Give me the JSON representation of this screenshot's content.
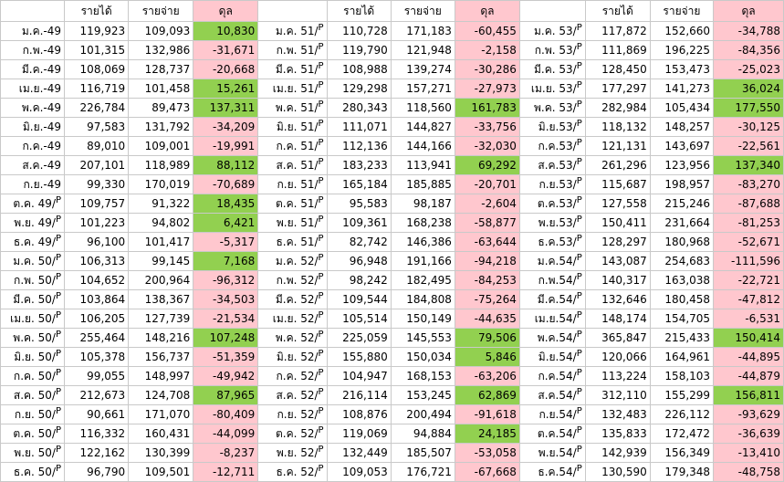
{
  "headers": {
    "income": "รายได้",
    "expense": "รายจ่าย",
    "balance": "ดุล"
  },
  "colors": {
    "surplus": "#92d050",
    "deficit": "#ffc7ce"
  },
  "rows": [
    [
      [
        "ม.ค.-49",
        "",
        "119,923",
        "109,093",
        "10,830"
      ],
      [
        "ม.ค. 51/",
        "P",
        "110,728",
        "171,183",
        "-60,455"
      ],
      [
        "ม.ค. 53/",
        "P",
        "117,872",
        "152,660",
        "-34,788"
      ]
    ],
    [
      [
        "ก.พ.-49",
        "",
        "101,315",
        "132,986",
        "-31,671"
      ],
      [
        "ก.พ. 51/",
        "P",
        "119,790",
        "121,948",
        "-2,158"
      ],
      [
        "ก.พ. 53/",
        "P",
        "111,869",
        "196,225",
        "-84,356"
      ]
    ],
    [
      [
        "มี.ค.-49",
        "",
        "108,069",
        "128,737",
        "-20,668"
      ],
      [
        "มี.ค. 51/",
        "P",
        "108,988",
        "139,274",
        "-30,286"
      ],
      [
        "มี.ค. 53/",
        "P",
        "128,450",
        "153,473",
        "-25,023"
      ]
    ],
    [
      [
        "เม.ย.-49",
        "",
        "116,719",
        "101,458",
        "15,261"
      ],
      [
        "เม.ย. 51/",
        "P",
        "129,298",
        "157,271",
        "-27,973"
      ],
      [
        "เม.ย. 53/",
        "P",
        "177,297",
        "141,273",
        "36,024"
      ]
    ],
    [
      [
        "พ.ค.-49",
        "",
        "226,784",
        "89,473",
        "137,311"
      ],
      [
        "พ.ค. 51/",
        "P",
        "280,343",
        "118,560",
        "161,783"
      ],
      [
        "พ.ค. 53/",
        "P",
        "282,984",
        "105,434",
        "177,550"
      ]
    ],
    [
      [
        "มิ.ย.-49",
        "",
        "97,583",
        "131,792",
        "-34,209"
      ],
      [
        "มิ.ย. 51/",
        "P",
        "111,071",
        "144,827",
        "-33,756"
      ],
      [
        "มิ.ย.53/",
        "P",
        "118,132",
        "148,257",
        "-30,125"
      ]
    ],
    [
      [
        "ก.ค.-49",
        "",
        "89,010",
        "109,001",
        "-19,991"
      ],
      [
        "ก.ค. 51/",
        "P",
        "112,136",
        "144,166",
        "-32,030"
      ],
      [
        "ก.ค.53/",
        "P",
        "121,131",
        "143,697",
        "-22,561"
      ]
    ],
    [
      [
        "ส.ค.-49",
        "",
        "207,101",
        "118,989",
        "88,112"
      ],
      [
        "ส.ค. 51/",
        "P",
        "183,233",
        "113,941",
        "69,292"
      ],
      [
        "ส.ค.53/",
        "P",
        "261,296",
        "123,956",
        "137,340"
      ]
    ],
    [
      [
        "ก.ย.-49",
        "",
        "99,330",
        "170,019",
        "-70,689"
      ],
      [
        "ก.ย. 51/",
        "P",
        "165,184",
        "185,885",
        "-20,701"
      ],
      [
        "ก.ย.53/",
        "P",
        "115,687",
        "198,957",
        "-83,270"
      ]
    ],
    [
      [
        "ต.ค. 49/",
        "P",
        "109,757",
        "91,322",
        "18,435"
      ],
      [
        "ต.ค. 51/",
        "P",
        "95,583",
        "98,187",
        "-2,604"
      ],
      [
        "ต.ค.53/",
        "P",
        "127,558",
        "215,246",
        "-87,688"
      ]
    ],
    [
      [
        "พ.ย. 49/",
        "P",
        "101,223",
        "94,802",
        "6,421"
      ],
      [
        "พ.ย. 51/",
        "P",
        "109,361",
        "168,238",
        "-58,877"
      ],
      [
        "พ.ย.53/",
        "P",
        "150,411",
        "231,664",
        "-81,253"
      ]
    ],
    [
      [
        "ธ.ค. 49/",
        "P",
        "96,100",
        "101,417",
        "-5,317"
      ],
      [
        "ธ.ค. 51/",
        "P",
        "82,742",
        "146,386",
        "-63,644"
      ],
      [
        "ธ.ค.53/",
        "P",
        "128,297",
        "180,968",
        "-52,671"
      ]
    ],
    [
      [
        "ม.ค. 50/",
        "P",
        "106,313",
        "99,145",
        "7,168"
      ],
      [
        "ม.ค. 52/",
        "P",
        "96,948",
        "191,166",
        "-94,218"
      ],
      [
        "ม.ค.54/",
        "P",
        "143,087",
        "254,683",
        "-111,596"
      ]
    ],
    [
      [
        "ก.พ. 50/",
        "P",
        "104,652",
        "200,964",
        "-96,312"
      ],
      [
        "ก.พ. 52/",
        "P",
        "98,242",
        "182,495",
        "-84,253"
      ],
      [
        "ก.พ.54/",
        "P",
        "140,317",
        "163,038",
        "-22,721"
      ]
    ],
    [
      [
        "มี.ค. 50/",
        "P",
        "103,864",
        "138,367",
        "-34,503"
      ],
      [
        "มี.ค. 52/",
        "P",
        "109,544",
        "184,808",
        "-75,264"
      ],
      [
        "มี.ค.54/",
        "P",
        "132,646",
        "180,458",
        "-47,812"
      ]
    ],
    [
      [
        "เม.ย. 50/",
        "P",
        "106,205",
        "127,739",
        "-21,534"
      ],
      [
        "เม.ย. 52/",
        "P",
        "105,514",
        "150,149",
        "-44,635"
      ],
      [
        "เม.ย.54/",
        "P",
        "148,174",
        "154,705",
        "-6,531"
      ]
    ],
    [
      [
        "พ.ค. 50/",
        "P",
        "255,464",
        "148,216",
        "107,248"
      ],
      [
        "พ.ค. 52/",
        "P",
        "225,059",
        "145,553",
        "79,506"
      ],
      [
        "พ.ค.54/",
        "P",
        "365,847",
        "215,433",
        "150,414"
      ]
    ],
    [
      [
        "มิ.ย. 50/",
        "P",
        "105,378",
        "156,737",
        "-51,359"
      ],
      [
        "มิ.ย. 52/",
        "P",
        "155,880",
        "150,034",
        "5,846"
      ],
      [
        "มิ.ย.54/",
        "P",
        "120,066",
        "164,961",
        "-44,895"
      ]
    ],
    [
      [
        "ก.ค. 50/",
        "P",
        "99,055",
        "148,997",
        "-49,942"
      ],
      [
        "ก.ค. 52/",
        "P",
        "104,947",
        "168,153",
        "-63,206"
      ],
      [
        "ก.ค.54/",
        "P",
        "113,224",
        "158,103",
        "-44,879"
      ]
    ],
    [
      [
        "ส.ค. 50/",
        "P",
        "212,673",
        "124,708",
        "87,965"
      ],
      [
        "ส.ค. 52/",
        "P",
        "216,114",
        "153,245",
        "62,869"
      ],
      [
        "ส.ค.54/",
        "P",
        "312,110",
        "155,299",
        "156,811"
      ]
    ],
    [
      [
        "ก.ย. 50/",
        "P",
        "90,661",
        "171,070",
        "-80,409"
      ],
      [
        "ก.ย. 52/",
        "P",
        "108,876",
        "200,494",
        "-91,618"
      ],
      [
        "ก.ย.54/",
        "P",
        "132,483",
        "226,112",
        "-93,629"
      ]
    ],
    [
      [
        "ต.ค. 50/",
        "P",
        "116,332",
        "160,431",
        "-44,099"
      ],
      [
        "ต.ค. 52/",
        "P",
        "119,069",
        "94,884",
        "24,185"
      ],
      [
        "ต.ค.54/",
        "P",
        "135,833",
        "172,472",
        "-36,639"
      ]
    ],
    [
      [
        "พ.ย. 50/",
        "P",
        "122,162",
        "130,399",
        "-8,237"
      ],
      [
        "พ.ย. 52/",
        "P",
        "132,449",
        "185,507",
        "-53,058"
      ],
      [
        "พ.ย.54/",
        "P",
        "142,939",
        "156,349",
        "-13,410"
      ]
    ],
    [
      [
        "ธ.ค. 50/",
        "P",
        "96,790",
        "109,501",
        "-12,711"
      ],
      [
        "ธ.ค. 52/",
        "P",
        "109,053",
        "176,721",
        "-67,668"
      ],
      [
        "ธ.ค.54/",
        "P",
        "130,590",
        "179,348",
        "-48,758"
      ]
    ]
  ]
}
